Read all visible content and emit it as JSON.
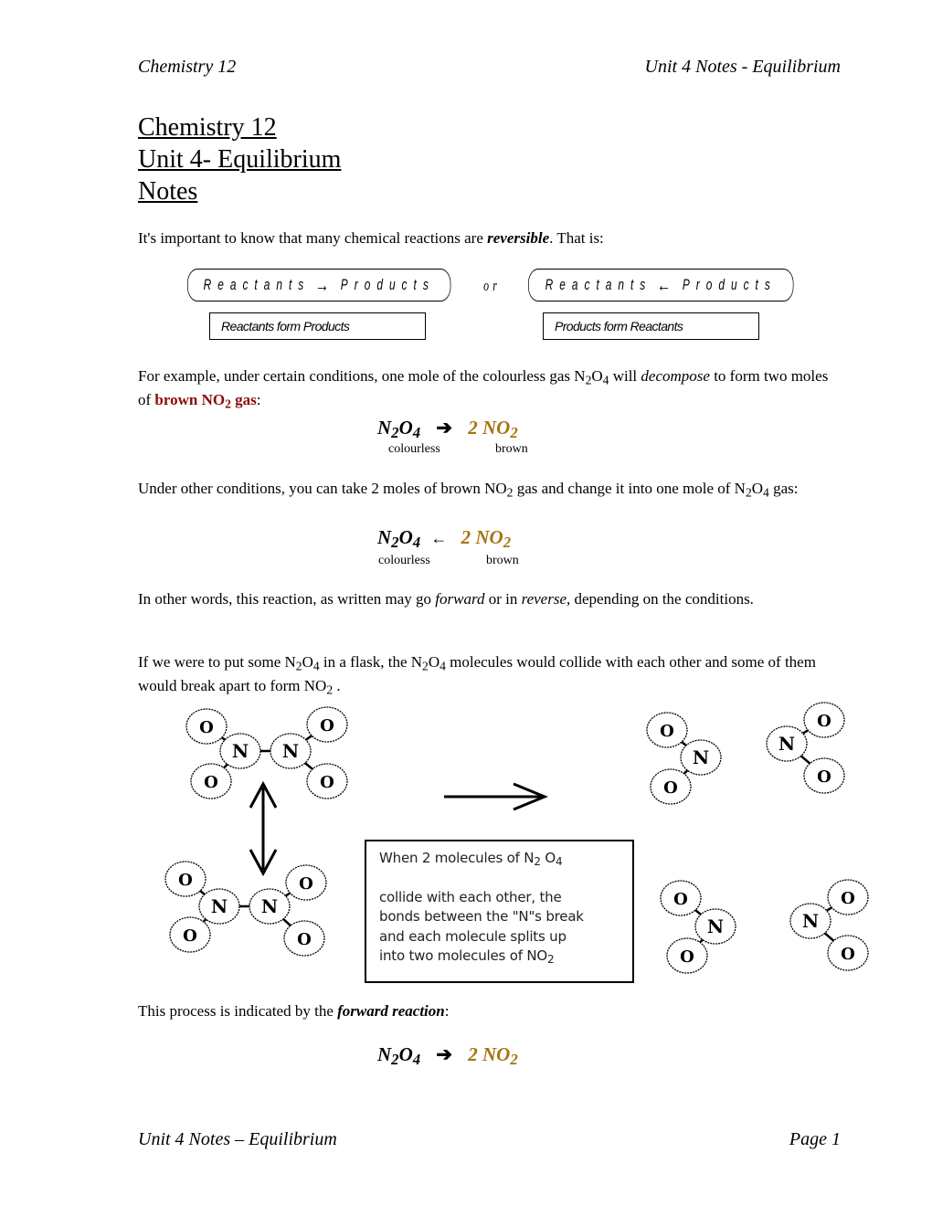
{
  "header": {
    "left": "Chemistry 12",
    "right": "Unit 4 Notes - Equilibrium"
  },
  "title": {
    "line1": "Chemistry 12",
    "line2": "Unit 4- Equilibrium",
    "line3": "Notes"
  },
  "intro": {
    "text_before": "It's important to know that many chemical reactions are ",
    "emphasis": "reversible",
    "text_after": ". That is:"
  },
  "reversible_diagram": {
    "forward": {
      "left": "Reactants",
      "arrow": "→",
      "right": "Products",
      "label": "Reactants form Products"
    },
    "connector": "or",
    "reverse": {
      "left": "Reactants",
      "arrow": "←",
      "right": "Products",
      "label": "Products form Reactants"
    }
  },
  "example1": {
    "text_a": "For example, under certain conditions, one mole of the colourless gas N",
    "sub_a": "2",
    "text_b": "O",
    "sub_b": "4",
    "text_c": " will ",
    "emphasis": "decompose",
    "text_d": " to form two moles of ",
    "highlight_a": "brown NO",
    "highlight_sub": "2",
    "highlight_b": " gas",
    "text_e": ":"
  },
  "equation_forward": {
    "reactant": "N",
    "r_sub1": "2",
    "r_mid": "O",
    "r_sub2": "4",
    "arrow": "➔",
    "product": "2 NO",
    "p_sub": "2",
    "label_reactant": "colourless",
    "label_product": "brown",
    "product_color": "#a6740f"
  },
  "example2": {
    "text_a": "Under other conditions, you can take 2 moles of brown NO",
    "sub_a": "2",
    "text_b": " gas and change it into one mole of N",
    "sub_b": "2",
    "text_c": "O",
    "sub_c": "4",
    "text_d": " gas:"
  },
  "equation_reverse": {
    "reactant": "N",
    "r_sub1": "2",
    "r_mid": "O",
    "r_sub2": "4",
    "arrow": "←",
    "product": "2 NO",
    "p_sub": "2",
    "label_reactant": "colourless",
    "label_product": "brown"
  },
  "para3": {
    "text_a": "In other words, this reaction, as written may go ",
    "em1": "forward",
    "text_b": " or in ",
    "em2": "reverse,",
    "text_c": "  depending on the conditions."
  },
  "para4": {
    "text_a": "If we were to put some N",
    "sub_a": "2",
    "text_b": "O",
    "sub_b": "4",
    "text_c": "  in a flask, the N",
    "sub_c": "2",
    "text_d": "O",
    "sub_d": "4",
    "text_e": " molecules would collide with each other and some of them would break apart to form  NO",
    "sub_e": "2",
    "text_f": " ."
  },
  "figure": {
    "atom_N": "N",
    "atom_O": "O",
    "caption": {
      "line1_a": "When 2 molecules of N",
      "line1_sub1": "2",
      "line1_b": " O",
      "line1_sub2": "4",
      "line2": "collide with each other, the",
      "line3": "bonds between the \"N\"s break",
      "line4": "and each molecule splits up",
      "line5_a": "into two molecules of NO",
      "line5_sub": "2"
    }
  },
  "para5": {
    "text_a": "This process is indicated by the ",
    "emphasis": "forward reaction",
    "text_b": ":"
  },
  "equation_final": {
    "reactant": "N",
    "r_sub1": "2",
    "r_mid": "O",
    "r_sub2": "4",
    "arrow": "➔",
    "product": "2 NO",
    "p_sub": "2"
  },
  "footer": {
    "left": "Unit 4 Notes – Equilibrium",
    "right": "Page 1"
  }
}
